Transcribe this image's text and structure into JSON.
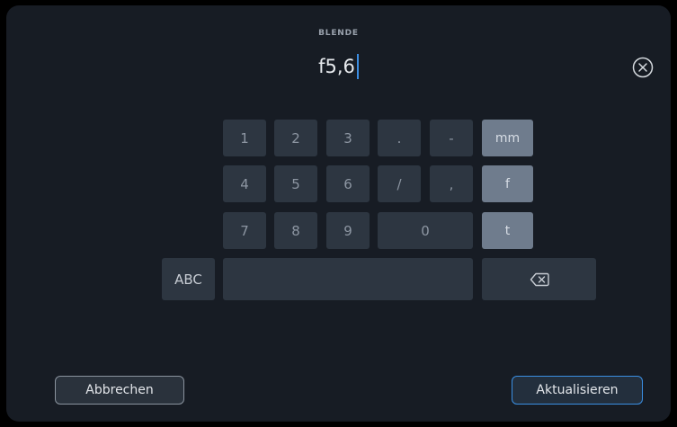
{
  "field": {
    "label": "BLENDE",
    "value": "f5,6"
  },
  "keypad": {
    "row1": [
      "1",
      "2",
      "3",
      ".",
      "-",
      "mm"
    ],
    "row2": [
      "4",
      "5",
      "6",
      "/",
      ",",
      "f"
    ],
    "row3": [
      "7",
      "8",
      "9",
      "0",
      "t"
    ],
    "abc_label": "ABC"
  },
  "icons": {
    "clear": "close-circle-icon",
    "backspace": "backspace-icon"
  },
  "buttons": {
    "cancel_label": "Abbrechen",
    "update_label": "Aktualisieren"
  },
  "colors": {
    "accent": "#3a8fe3",
    "background": "#171c24",
    "key": "#2d3641",
    "unit_key": "#6f7c8d"
  }
}
